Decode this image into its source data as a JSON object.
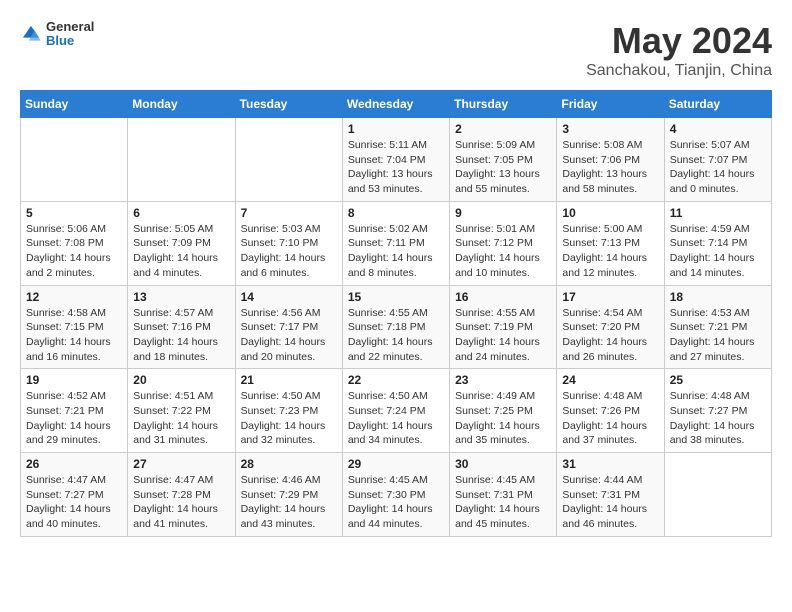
{
  "logo": {
    "general": "General",
    "blue": "Blue"
  },
  "title": "May 2024",
  "location": "Sanchakou, Tianjin, China",
  "days_of_week": [
    "Sunday",
    "Monday",
    "Tuesday",
    "Wednesday",
    "Thursday",
    "Friday",
    "Saturday"
  ],
  "weeks": [
    [
      {
        "day": "",
        "info": ""
      },
      {
        "day": "",
        "info": ""
      },
      {
        "day": "",
        "info": ""
      },
      {
        "day": "1",
        "info": "Sunrise: 5:11 AM\nSunset: 7:04 PM\nDaylight: 13 hours and 53 minutes."
      },
      {
        "day": "2",
        "info": "Sunrise: 5:09 AM\nSunset: 7:05 PM\nDaylight: 13 hours and 55 minutes."
      },
      {
        "day": "3",
        "info": "Sunrise: 5:08 AM\nSunset: 7:06 PM\nDaylight: 13 hours and 58 minutes."
      },
      {
        "day": "4",
        "info": "Sunrise: 5:07 AM\nSunset: 7:07 PM\nDaylight: 14 hours and 0 minutes."
      }
    ],
    [
      {
        "day": "5",
        "info": "Sunrise: 5:06 AM\nSunset: 7:08 PM\nDaylight: 14 hours and 2 minutes."
      },
      {
        "day": "6",
        "info": "Sunrise: 5:05 AM\nSunset: 7:09 PM\nDaylight: 14 hours and 4 minutes."
      },
      {
        "day": "7",
        "info": "Sunrise: 5:03 AM\nSunset: 7:10 PM\nDaylight: 14 hours and 6 minutes."
      },
      {
        "day": "8",
        "info": "Sunrise: 5:02 AM\nSunset: 7:11 PM\nDaylight: 14 hours and 8 minutes."
      },
      {
        "day": "9",
        "info": "Sunrise: 5:01 AM\nSunset: 7:12 PM\nDaylight: 14 hours and 10 minutes."
      },
      {
        "day": "10",
        "info": "Sunrise: 5:00 AM\nSunset: 7:13 PM\nDaylight: 14 hours and 12 minutes."
      },
      {
        "day": "11",
        "info": "Sunrise: 4:59 AM\nSunset: 7:14 PM\nDaylight: 14 hours and 14 minutes."
      }
    ],
    [
      {
        "day": "12",
        "info": "Sunrise: 4:58 AM\nSunset: 7:15 PM\nDaylight: 14 hours and 16 minutes."
      },
      {
        "day": "13",
        "info": "Sunrise: 4:57 AM\nSunset: 7:16 PM\nDaylight: 14 hours and 18 minutes."
      },
      {
        "day": "14",
        "info": "Sunrise: 4:56 AM\nSunset: 7:17 PM\nDaylight: 14 hours and 20 minutes."
      },
      {
        "day": "15",
        "info": "Sunrise: 4:55 AM\nSunset: 7:18 PM\nDaylight: 14 hours and 22 minutes."
      },
      {
        "day": "16",
        "info": "Sunrise: 4:55 AM\nSunset: 7:19 PM\nDaylight: 14 hours and 24 minutes."
      },
      {
        "day": "17",
        "info": "Sunrise: 4:54 AM\nSunset: 7:20 PM\nDaylight: 14 hours and 26 minutes."
      },
      {
        "day": "18",
        "info": "Sunrise: 4:53 AM\nSunset: 7:21 PM\nDaylight: 14 hours and 27 minutes."
      }
    ],
    [
      {
        "day": "19",
        "info": "Sunrise: 4:52 AM\nSunset: 7:21 PM\nDaylight: 14 hours and 29 minutes."
      },
      {
        "day": "20",
        "info": "Sunrise: 4:51 AM\nSunset: 7:22 PM\nDaylight: 14 hours and 31 minutes."
      },
      {
        "day": "21",
        "info": "Sunrise: 4:50 AM\nSunset: 7:23 PM\nDaylight: 14 hours and 32 minutes."
      },
      {
        "day": "22",
        "info": "Sunrise: 4:50 AM\nSunset: 7:24 PM\nDaylight: 14 hours and 34 minutes."
      },
      {
        "day": "23",
        "info": "Sunrise: 4:49 AM\nSunset: 7:25 PM\nDaylight: 14 hours and 35 minutes."
      },
      {
        "day": "24",
        "info": "Sunrise: 4:48 AM\nSunset: 7:26 PM\nDaylight: 14 hours and 37 minutes."
      },
      {
        "day": "25",
        "info": "Sunrise: 4:48 AM\nSunset: 7:27 PM\nDaylight: 14 hours and 38 minutes."
      }
    ],
    [
      {
        "day": "26",
        "info": "Sunrise: 4:47 AM\nSunset: 7:27 PM\nDaylight: 14 hours and 40 minutes."
      },
      {
        "day": "27",
        "info": "Sunrise: 4:47 AM\nSunset: 7:28 PM\nDaylight: 14 hours and 41 minutes."
      },
      {
        "day": "28",
        "info": "Sunrise: 4:46 AM\nSunset: 7:29 PM\nDaylight: 14 hours and 43 minutes."
      },
      {
        "day": "29",
        "info": "Sunrise: 4:45 AM\nSunset: 7:30 PM\nDaylight: 14 hours and 44 minutes."
      },
      {
        "day": "30",
        "info": "Sunrise: 4:45 AM\nSunset: 7:31 PM\nDaylight: 14 hours and 45 minutes."
      },
      {
        "day": "31",
        "info": "Sunrise: 4:44 AM\nSunset: 7:31 PM\nDaylight: 14 hours and 46 minutes."
      },
      {
        "day": "",
        "info": ""
      }
    ]
  ]
}
